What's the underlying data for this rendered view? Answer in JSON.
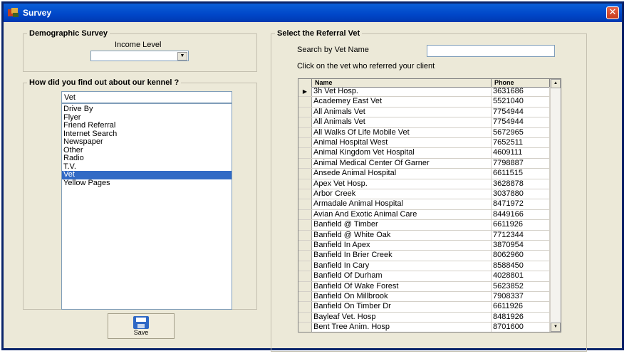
{
  "window": {
    "title": "Survey",
    "close_glyph": "✕"
  },
  "demographic": {
    "legend": "Demographic Survey",
    "income_label": "Income Level",
    "income_value": ""
  },
  "kennel": {
    "legend": "How did you find out about our kennel ?",
    "selected_text": "Vet",
    "options": [
      "Drive By",
      "Flyer",
      "Friend Referral",
      "Internet Search",
      "Newspaper",
      "Other",
      "Radio",
      "T.V.",
      "Vet",
      "Yellow Pages"
    ],
    "selected_index": 8
  },
  "save_button": {
    "label": "Save",
    "icon": "floppy-disk-icon"
  },
  "referral": {
    "legend": "Select the Referral Vet",
    "search_label": "Search by Vet Name",
    "search_value": "",
    "instruction": "Click on the vet who referred your client",
    "columns": [
      "Name",
      "Phone"
    ],
    "rows": [
      [
        "3h Vet Hosp.",
        "3631686"
      ],
      [
        "Academey East Vet",
        "5521040"
      ],
      [
        "All Animals Vet",
        "7754944"
      ],
      [
        "All Animals Vet",
        "7754944"
      ],
      [
        "All Walks Of Life Mobile Vet",
        "5672965"
      ],
      [
        "Animal Hospital West",
        "7652511"
      ],
      [
        "Animal Kingdom Vet Hospital",
        "4609111"
      ],
      [
        "Animal Medical Center Of Garner",
        "7798887"
      ],
      [
        "Ansede Animal Hospital",
        "6611515"
      ],
      [
        "Apex Vet Hosp.",
        "3628878"
      ],
      [
        "Arbor Creek",
        "3037880"
      ],
      [
        "Armadale Animal Hospital",
        "8471972"
      ],
      [
        "Avian And Exotic Animal Care",
        "8449166"
      ],
      [
        "Banfield @ Timber",
        "6611926"
      ],
      [
        "Banfield @ White Oak",
        "7712344"
      ],
      [
        "Banfield In Apex",
        "3870954"
      ],
      [
        "Banfield In Brier Creek",
        "8062960"
      ],
      [
        "Banfield In Cary",
        "8588450"
      ],
      [
        "Banfield Of Durham",
        "4028801"
      ],
      [
        "Banfield Of Wake Forest",
        "5623852"
      ],
      [
        "Banfield On  Millbrook",
        "7908337"
      ],
      [
        "Banfield On Timber Dr",
        "6611926"
      ],
      [
        "Bayleaf Vet. Hosp",
        "8481926"
      ],
      [
        "Bent Tree Anim. Hosp",
        "8701600"
      ]
    ],
    "current_row_indicator": "▶"
  },
  "colors": {
    "titlebar": "#0046c8",
    "selection": "#316ac5",
    "face": "#ece9d8"
  }
}
